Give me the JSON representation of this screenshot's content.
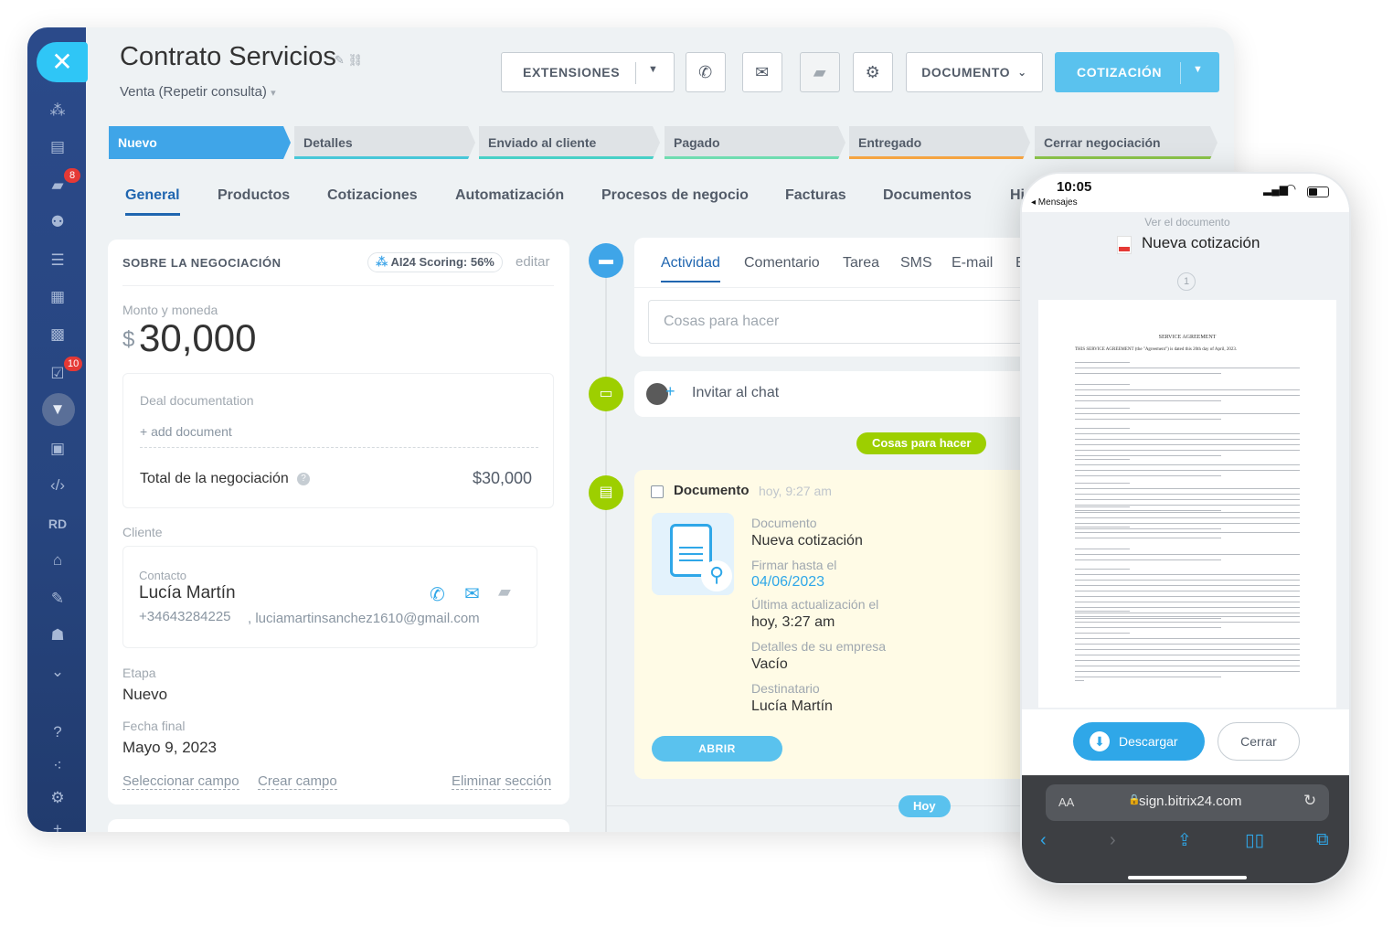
{
  "header": {
    "title": "Contrato Servicios",
    "subtitle": "Venta (Repetir consulta)"
  },
  "toolbar": {
    "extensions": "EXTENSIONES",
    "document": "DOCUMENTO",
    "quote": "COTIZACIÓN"
  },
  "sidebar": {
    "close_icon": "close-icon",
    "badge_chat": "8",
    "badge_tasks": "10",
    "rd_label": "RD"
  },
  "stages": [
    "Nuevo",
    "Detalles",
    "Enviado al cliente",
    "Pagado",
    "Entregado",
    "Cerrar negociación"
  ],
  "tabs": [
    "General",
    "Productos",
    "Cotizaciones",
    "Automatización",
    "Procesos de negocio",
    "Facturas",
    "Documentos",
    "Hi"
  ],
  "about": {
    "heading": "SOBRE LA NEGOCIACIÓN",
    "scoring": "AI24 Scoring: 56%",
    "edit": "editar",
    "amount_label": "Monto y moneda",
    "currency": "$",
    "amount": "30,000",
    "doc_label": "Deal documentation",
    "add_doc": "+ add document",
    "total_label": "Total de la negociación",
    "total_value": "$30,000",
    "client_label": "Cliente",
    "contact_label": "Contacto",
    "contact_name": "Lucía Martín",
    "phone": "+34643284225",
    "email": ", luciamartinsanchez1610@gmail.com",
    "stage_label": "Etapa",
    "stage_value": "Nuevo",
    "date_label": "Fecha final",
    "date_value": "Mayo 9, 2023",
    "select_field": "Seleccionar campo",
    "create_field": "Crear campo",
    "delete_section": "Eliminar sección"
  },
  "activity": {
    "tabs": [
      "Actividad",
      "Comentario",
      "Tarea",
      "SMS",
      "E-mail",
      "E"
    ],
    "todo_placeholder": "Cosas para hacer",
    "invite_chat": "Invitar al chat",
    "todo_badge": "Cosas para hacer",
    "doc_title": "Documento",
    "doc_time": "hoy, 9:27 am",
    "fields": [
      {
        "label": "Documento",
        "value": "Nueva cotización"
      },
      {
        "label": "Firmar hasta el",
        "value": "04/06/2023"
      },
      {
        "label": "Última actualización el",
        "value": "hoy, 3:27 am"
      },
      {
        "label": "Detalles de su empresa",
        "value": "Vacío"
      },
      {
        "label": "Destinatario",
        "value": "Lucía Martín"
      }
    ],
    "open_btn": "ABRIR",
    "today": "Hoy"
  },
  "phone": {
    "time": "10:05",
    "back_label": "◂ Mensajes",
    "view_doc": "Ver el documento",
    "doc_title": "Nueva cotización",
    "page_num": "1",
    "doc_heading": "SERVICE AGREEMENT",
    "doc_intro": "THIS SERVICE AGREEMENT (the \"Agreement\") is dated this 20th day of April, 2023.",
    "download": "Descargar",
    "close": "Cerrar",
    "url_aa": "AA",
    "url": "sign.bitrix24.com"
  }
}
